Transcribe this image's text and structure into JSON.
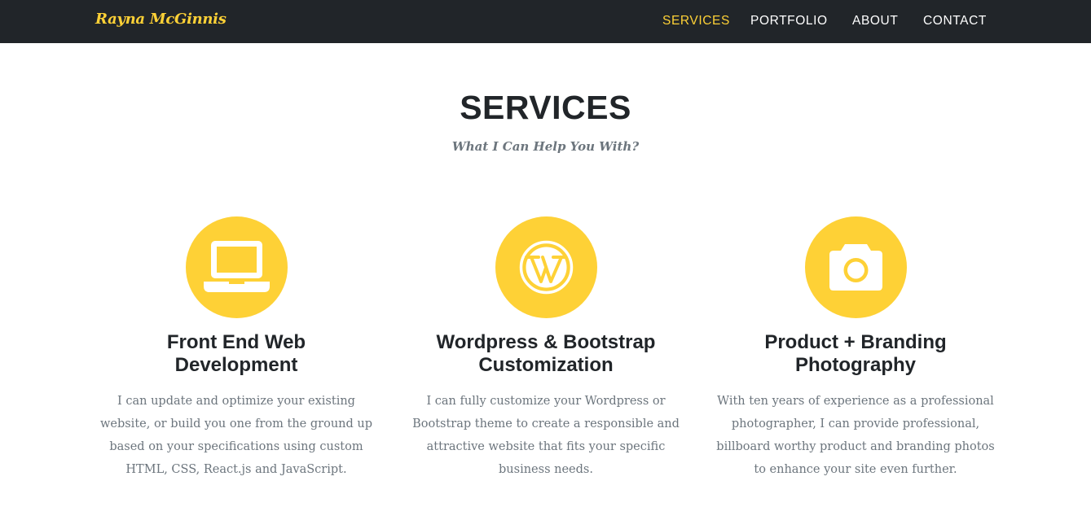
{
  "navbar": {
    "brand": "Rayna McGinnis",
    "links": [
      {
        "label": "SERVICES",
        "active": true
      },
      {
        "label": "PORTFOLIO",
        "active": false
      },
      {
        "label": "ABOUT",
        "active": false
      },
      {
        "label": "CONTACT",
        "active": false
      }
    ]
  },
  "services": {
    "heading": "SERVICES",
    "subheading": "What I Can Help You With?",
    "items": [
      {
        "icon": "laptop-icon",
        "title_line1": "Front End Web",
        "title_line2": "Development",
        "description": "I can update and optimize your existing website, or build you one from the ground up based on your specifications using custom HTML, CSS, React.js and JavaScript."
      },
      {
        "icon": "wordpress-icon",
        "title_line1": "Wordpress & Bootstrap",
        "title_line2": "Customization",
        "description": "I can fully customize your Wordpress or Bootstrap theme to create a responsible and attractive website that fits your specific business needs."
      },
      {
        "icon": "camera-icon",
        "title_line1": "Product + Branding",
        "title_line2": "Photography",
        "description": "With ten years of experience as a professional photographer, I can provide professional, billboard worthy product and branding photos to enhance your site even further."
      }
    ]
  },
  "colors": {
    "navbar_background": "#212529",
    "accent": "#fed136",
    "heading_text": "#212529",
    "muted_text": "#6c757d",
    "icon_glyph": "#ffffff"
  }
}
